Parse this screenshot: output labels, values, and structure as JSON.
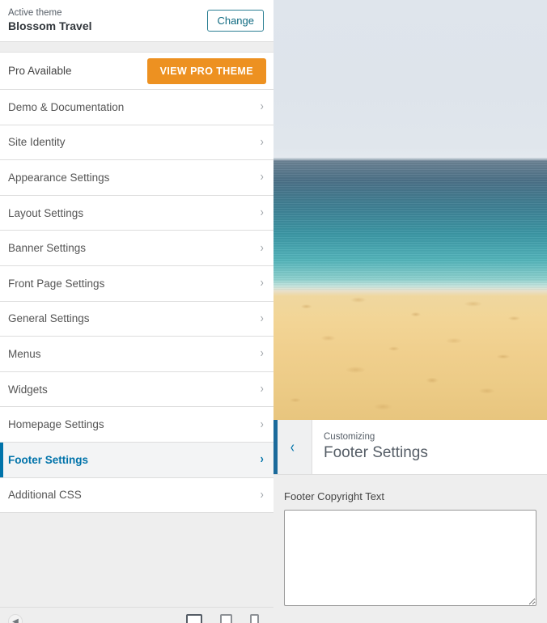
{
  "sidebar": {
    "theme_header": {
      "active_theme_label": "Active theme",
      "theme_name": "Blossom Travel",
      "change_button": "Change"
    },
    "pro_row": {
      "label": "Pro Available",
      "button": "VIEW PRO THEME"
    },
    "menu_items": [
      {
        "label": "Demo & Documentation",
        "active": false
      },
      {
        "label": "Site Identity",
        "active": false
      },
      {
        "label": "Appearance Settings",
        "active": false
      },
      {
        "label": "Layout Settings",
        "active": false
      },
      {
        "label": "Banner Settings",
        "active": false
      },
      {
        "label": "Front Page Settings",
        "active": false
      },
      {
        "label": "General Settings",
        "active": false
      },
      {
        "label": "Menus",
        "active": false
      },
      {
        "label": "Widgets",
        "active": false
      },
      {
        "label": "Homepage Settings",
        "active": false
      },
      {
        "label": "Footer Settings",
        "active": true
      },
      {
        "label": "Additional CSS",
        "active": false
      }
    ],
    "chevron_glyph": "›",
    "bottom_bar": {
      "collapse_icon": "collapse-sidebar-icon",
      "devices": [
        {
          "name": "desktop-preview-icon",
          "selected": true
        },
        {
          "name": "tablet-preview-icon",
          "selected": false
        },
        {
          "name": "mobile-preview-icon",
          "selected": false
        }
      ]
    }
  },
  "panel": {
    "back_chevron": "‹",
    "customizing_label": "Customizing",
    "title": "Footer Settings",
    "controls": {
      "copyright_label": "Footer Copyright Text",
      "copyright_value": "",
      "copyright_placeholder": ""
    }
  },
  "preview": {
    "alt": "beach-photo-preview",
    "colors": {
      "sky": "#dfe5ec",
      "deep_water": "#4c7188",
      "shallow_water": "#54b5bb",
      "foam": "#c8e7e0",
      "sand": "#f2d596"
    }
  },
  "theme_colors": {
    "accent_blue": "#0073aa",
    "pro_orange": "#ed9121",
    "change_border": "#2b7f93",
    "panel_bg": "#eeeeee"
  }
}
